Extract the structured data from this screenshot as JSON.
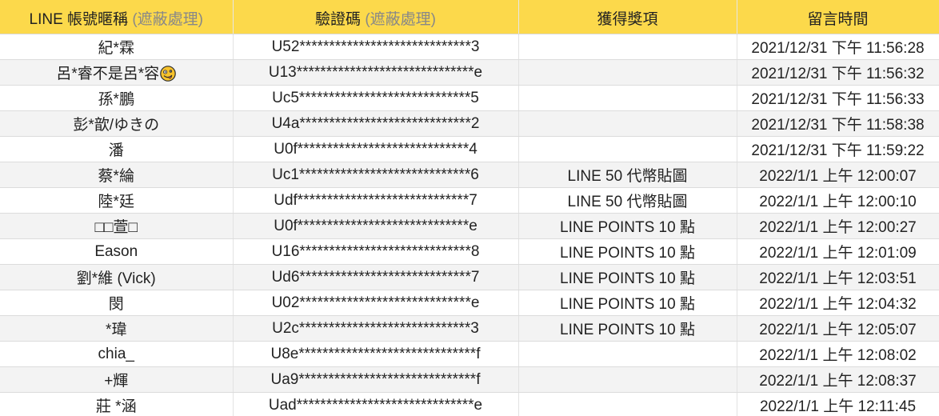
{
  "headers": {
    "name_main": "LINE 帳號暱稱 ",
    "name_muted": "(遮蔽處理)",
    "code_main": "驗證碼 ",
    "code_muted": "(遮蔽處理)",
    "prize": "獲得獎項",
    "time": "留言時間"
  },
  "rows": [
    {
      "name": "紀*霖",
      "code": "U52*****************************3",
      "prize": "",
      "time": "2021/12/31 下午 11:56:28"
    },
    {
      "name": "呂*睿不是呂*容",
      "code": "U13******************************e",
      "prize": "",
      "time": "2021/12/31 下午 11:56:32",
      "emoji": "zany-face-emoji"
    },
    {
      "name": "孫*鵬",
      "code": "Uc5*****************************5",
      "prize": "",
      "time": "2021/12/31 下午 11:56:33"
    },
    {
      "name": "彭*歆/ゆきの",
      "code": "U4a*****************************2",
      "prize": "",
      "time": "2021/12/31 下午 11:58:38"
    },
    {
      "name": "潘",
      "code": "U0f*****************************4",
      "prize": "",
      "time": "2021/12/31 下午 11:59:22"
    },
    {
      "name": "蔡*綸",
      "code": "Uc1*****************************6",
      "prize": "LINE 50 代幣貼圖",
      "time": "2022/1/1 上午 12:00:07"
    },
    {
      "name": "陸*廷",
      "code": "Udf*****************************7",
      "prize": "LINE 50 代幣貼圖",
      "time": "2022/1/1 上午 12:00:10"
    },
    {
      "name": "□□萱□",
      "code": "U0f*****************************e",
      "prize": "LINE POINTS 10 點",
      "time": "2022/1/1 上午 12:00:27"
    },
    {
      "name": "Eason",
      "code": "U16*****************************8",
      "prize": "LINE POINTS 10 點",
      "time": "2022/1/1 上午 12:01:09"
    },
    {
      "name": "劉*維 (Vick)",
      "code": "Ud6*****************************7",
      "prize": "LINE POINTS 10 點",
      "time": "2022/1/1 上午 12:03:51"
    },
    {
      "name": "閔",
      "code": "U02*****************************e",
      "prize": "LINE POINTS 10 點",
      "time": "2022/1/1 上午 12:04:32"
    },
    {
      "name": "*瑋",
      "code": "U2c*****************************3",
      "prize": "LINE POINTS 10 點",
      "time": "2022/1/1 上午 12:05:07"
    },
    {
      "name": "chia_",
      "code": "U8e******************************f",
      "prize": "",
      "time": "2022/1/1 上午 12:08:02"
    },
    {
      "name": "+輝",
      "code": "Ua9******************************f",
      "prize": "",
      "time": "2022/1/1 上午 12:08:37"
    },
    {
      "name": "莊 *涵",
      "code": "Uad******************************e",
      "prize": "",
      "time": "2022/1/1 上午 12:11:45"
    }
  ],
  "colors": {
    "header_bg": "#fcd94b",
    "alt_row_bg": "#f3f3f3",
    "grid_line": "#dcdcdc"
  }
}
